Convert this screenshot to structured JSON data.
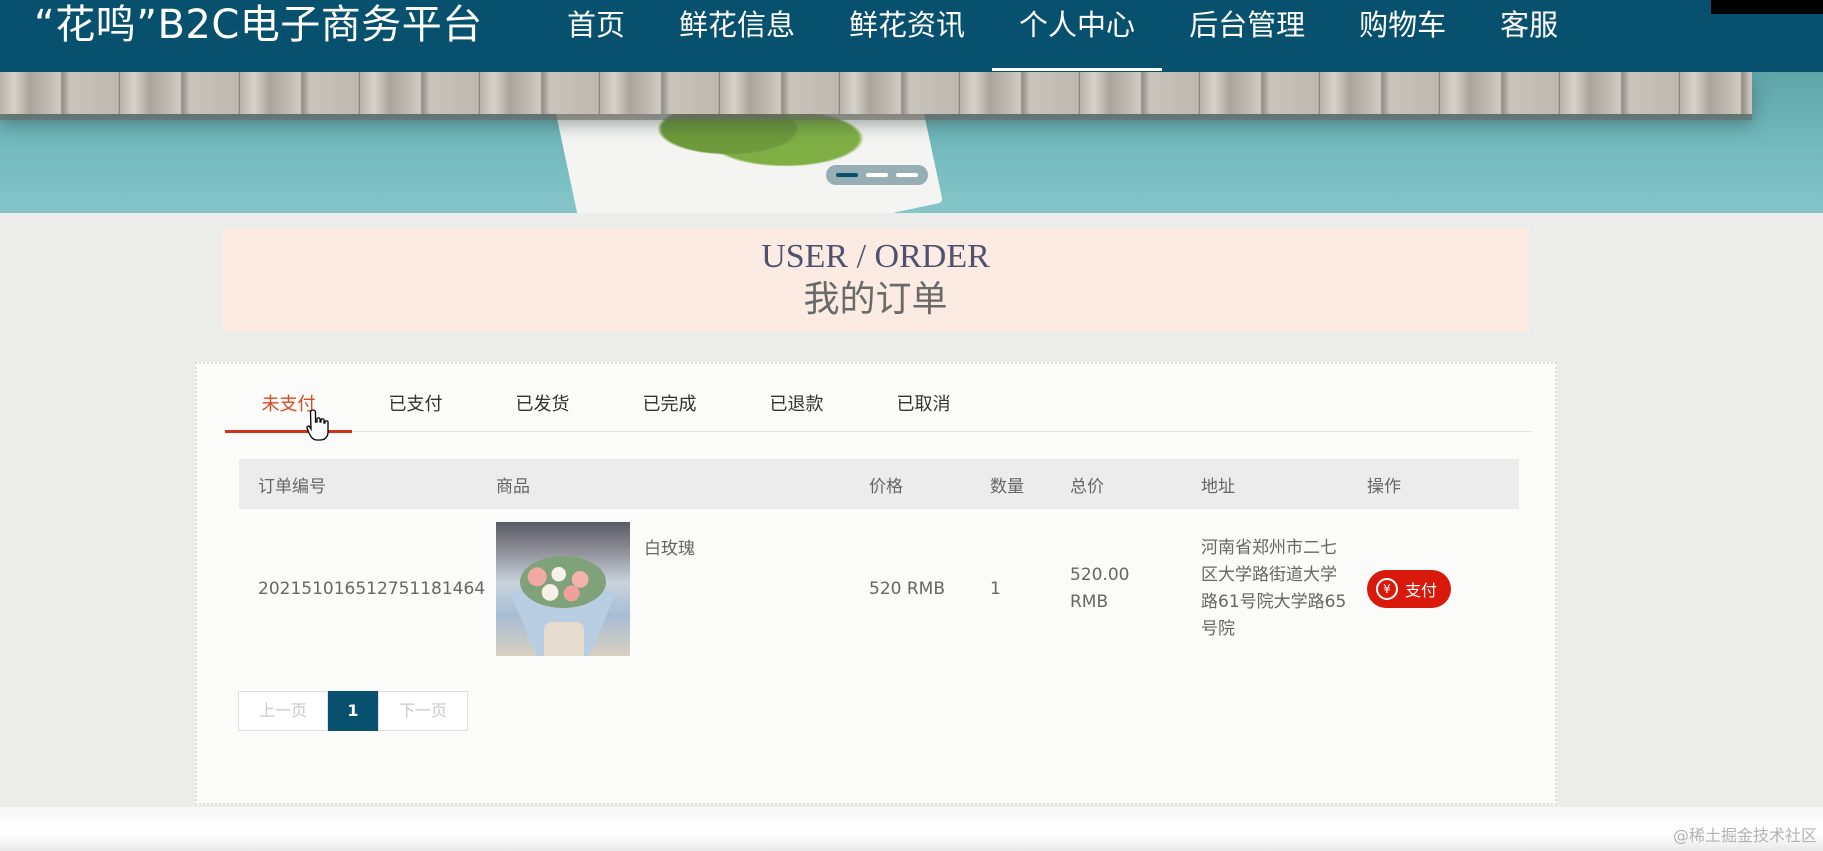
{
  "header": {
    "brand": "“花鸣”B2C电子商务平台",
    "nav": [
      "首页",
      "鲜花信息",
      "鲜花资讯",
      "个人中心",
      "后台管理",
      "购物车",
      "客服"
    ],
    "active_nav": "个人中心",
    "bg_color": "#07516f"
  },
  "banner": {
    "slide_count": 3,
    "active_slide": 1
  },
  "title": {
    "en": "USER / ORDER",
    "cn": "我的订单"
  },
  "tabs": [
    "未支付",
    "已支付",
    "已发货",
    "已完成",
    "已退款",
    "已取消"
  ],
  "active_tab": "未支付",
  "table": {
    "headers": [
      "订单编号",
      "商品",
      "价格",
      "数量",
      "总价",
      "地址",
      "操作"
    ],
    "rows": [
      {
        "order_no": "20215101651275118146​4",
        "product_name": "白玫瑰",
        "price": "520 RMB",
        "quantity": "1",
        "total": "520.00 RMB",
        "address": "河南省郑州市二七区大学路街道大学路61号院大学路65号院",
        "action": "支付"
      }
    ]
  },
  "pager": {
    "prev": "上一页",
    "current": "1",
    "next": "下一页"
  },
  "watermark": "@稀土掘金技术社区",
  "colors": {
    "accent": "#d84a24",
    "pay_button": "#d9190c",
    "title_bg": "#fcebe3"
  }
}
